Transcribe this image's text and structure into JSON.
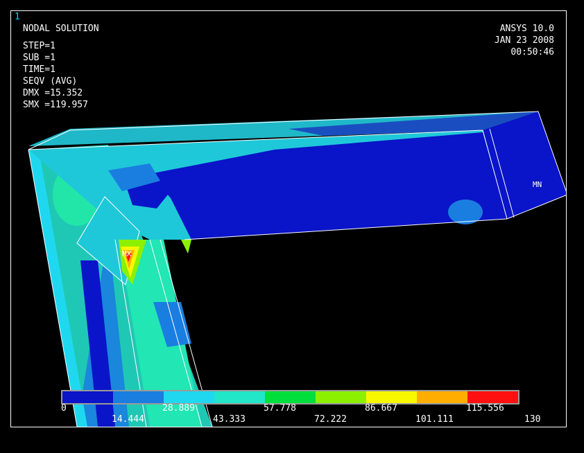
{
  "window": {
    "number": "1"
  },
  "plot": {
    "title": "NODAL SOLUTION",
    "info": [
      "STEP=1",
      "SUB =1",
      "TIME=1",
      "SEQV     (AVG)",
      "DMX =15.352",
      "SMX =119.957"
    ],
    "header": [
      "ANSYS 10.0",
      "JAN 23 2008",
      "00:50:46"
    ],
    "labels": {
      "mn": "MN",
      "mx": "MX"
    }
  },
  "legend": {
    "colors": [
      "#0a14c8",
      "#1a7ee0",
      "#1fd8f0",
      "#22e6c8",
      "#00e03c",
      "#8cf000",
      "#f8f800",
      "#ffae00",
      "#ff1010"
    ],
    "ticks_bottom_row1": [
      "0",
      "28.889",
      "57.778",
      "86.667",
      "115.556"
    ],
    "ticks_bottom_row2": [
      "14.444",
      "43.333",
      "72.222",
      "101.111",
      "130"
    ]
  }
}
